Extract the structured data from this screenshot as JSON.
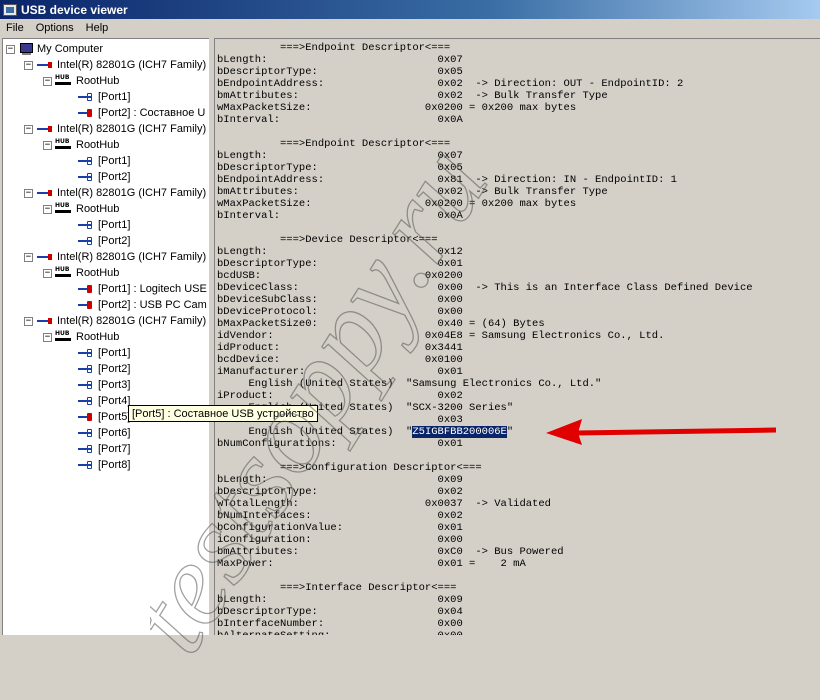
{
  "window": {
    "title": "USB device viewer"
  },
  "menu": [
    "File",
    "Options",
    "Help"
  ],
  "tree": {
    "root": "My Computer",
    "controllers": [
      {
        "label": "Intel(R) 82801G (ICH7 Family) U",
        "hub": "RootHub",
        "ports": [
          "[Port1]",
          "[Port2]  :  Составное U"
        ]
      },
      {
        "label": "Intel(R) 82801G (ICH7 Family) U",
        "hub": "RootHub",
        "ports": [
          "[Port1]",
          "[Port2]"
        ]
      },
      {
        "label": "Intel(R) 82801G (ICH7 Family) U",
        "hub": "RootHub",
        "ports": [
          "[Port1]",
          "[Port2]"
        ]
      },
      {
        "label": "Intel(R) 82801G (ICH7 Family) U",
        "hub": "RootHub",
        "ports": [
          "[Port1]  :  Logitech USE",
          "[Port2]  :  USB PC Cam"
        ]
      },
      {
        "label": "Intel(R) 82801G (ICH7 Family) U",
        "hub": "RootHub",
        "ports": [
          "[Port1]",
          "[Port2]",
          "[Port3]",
          "[Port4]",
          "[Port5]  :  Составное USB устройство",
          "[Port6]",
          "[Port7]",
          "[Port8]"
        ]
      }
    ],
    "hub_icon_text": "HUB",
    "tooltip": "[Port5]  :  Составное USB устройство"
  },
  "detail_lines": [
    "          ===>Endpoint Descriptor<===",
    "bLength:                           0x07",
    "bDescriptorType:                   0x05",
    "bEndpointAddress:                  0x02  -> Direction: OUT - EndpointID: 2",
    "bmAttributes:                      0x02  -> Bulk Transfer Type",
    "wMaxPacketSize:                  0x0200 = 0x200 max bytes",
    "bInterval:                         0x0A",
    "",
    "          ===>Endpoint Descriptor<===",
    "bLength:                           0x07",
    "bDescriptorType:                   0x05",
    "bEndpointAddress:                  0x81  -> Direction: IN - EndpointID: 1",
    "bmAttributes:                      0x02  -> Bulk Transfer Type",
    "wMaxPacketSize:                  0x0200 = 0x200 max bytes",
    "bInterval:                         0x0A",
    "",
    "          ===>Device Descriptor<===",
    "bLength:                           0x12",
    "bDescriptorType:                   0x01",
    "bcdUSB:                          0x0200",
    "bDeviceClass:                      0x00  -> This is an Interface Class Defined Device",
    "bDeviceSubClass:                   0x00",
    "bDeviceProtocol:                   0x00",
    "bMaxPacketSize0:                   0x40 = (64) Bytes",
    "idVendor:                        0x04E8 = Samsung Electronics Co., Ltd.",
    "idProduct:                       0x3441",
    "bcdDevice:                       0x0100",
    "iManufacturer:                     0x01",
    "     English (United States)  \"Samsung Electronics Co., Ltd.\"",
    "iProduct:                          0x02",
    "     English (United States)  \"SCX-3200 Series\"",
    "iSerialNumber:                     0x03",
    "     English (United States)  \"",
    "bNumConfigurations:                0x01",
    "",
    "          ===>Configuration Descriptor<===",
    "bLength:                           0x09",
    "bDescriptorType:                   0x02",
    "wTotalLength:                    0x0037  -> Validated",
    "bNumInterfaces:                    0x02",
    "bConfigurationValue:               0x01",
    "iConfiguration:                    0x00",
    "bmAttributes:                      0xC0  -> Bus Powered",
    "MaxPower:                          0x01 =    2 mA",
    "",
    "          ===>Interface Descriptor<===",
    "bLength:                           0x09",
    "bDescriptorType:                   0x04",
    "bInterfaceNumber:                  0x00",
    "bAlternateSetting:                 0x00"
  ],
  "serial": {
    "value": "Z5IGBFBB200006E",
    "suffix": "\""
  },
  "watermark": "testsoppy.ru",
  "colors": {
    "titlebar": "#0a246a",
    "highlight": "#0a246a",
    "arrow": "#e00000"
  }
}
